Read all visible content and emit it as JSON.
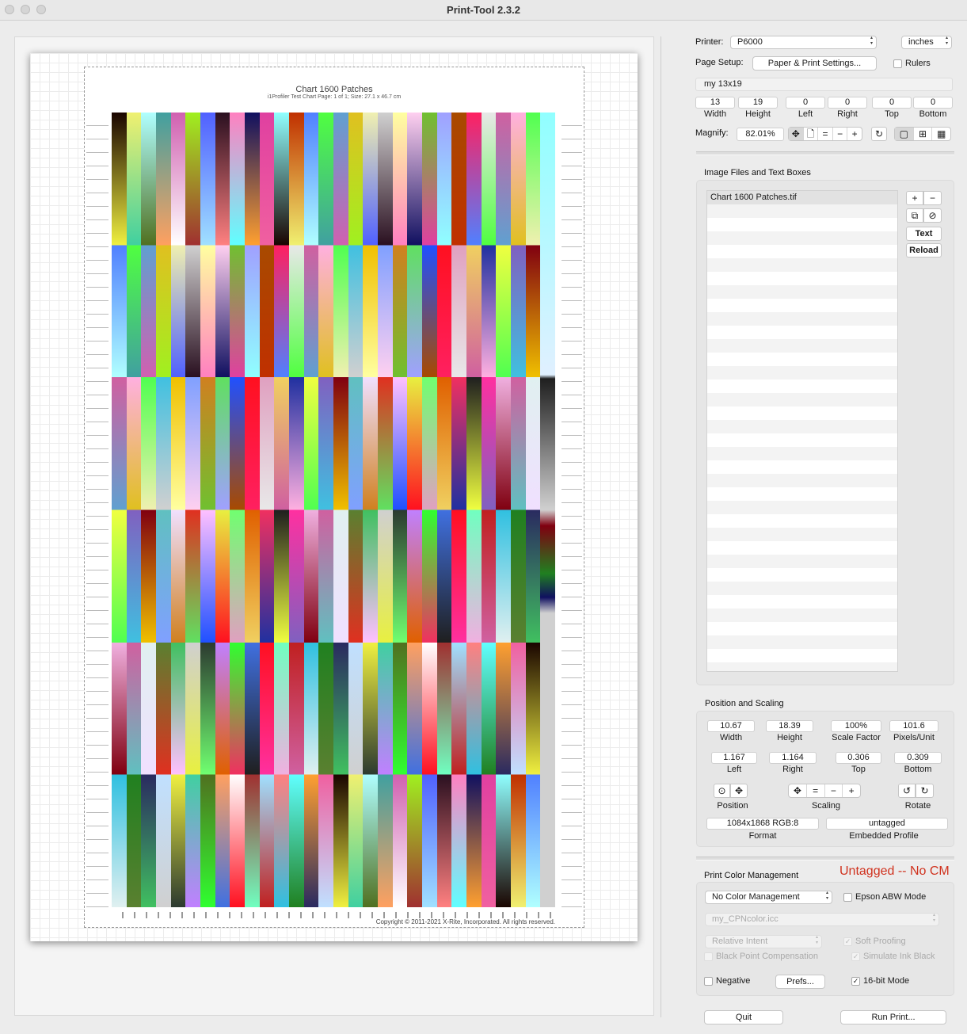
{
  "window": {
    "title": "Print-Tool 2.3.2"
  },
  "chart": {
    "title": "Chart 1600 Patches",
    "subtitle": "i1Profiler Test Chart Page: 1 of 1; Size: 27.1 x 46.7 cm",
    "copyright": "Copyright © 2011-2021 X-Rite, Incorporated. All rights reserved."
  },
  "printer": {
    "label": "Printer:",
    "value": "P6000",
    "units": "inches"
  },
  "page_setup": {
    "label": "Page Setup:",
    "button": "Paper & Print Settings...",
    "rulers_label": "Rulers",
    "paper_name": "my 13x19"
  },
  "paper_dims": [
    {
      "value": "13",
      "label": "Width"
    },
    {
      "value": "19",
      "label": "Height"
    },
    {
      "value": "0",
      "label": "Left"
    },
    {
      "value": "0",
      "label": "Right"
    },
    {
      "value": "0",
      "label": "Top"
    },
    {
      "value": "0",
      "label": "Bottom"
    }
  ],
  "magnify": {
    "label": "Magnify:",
    "value": "82.01%"
  },
  "image_files": {
    "title": "Image Files and Text Boxes",
    "items": [
      "Chart 1600 Patches.tif"
    ],
    "text_button": "Text",
    "reload_button": "Reload"
  },
  "position_scaling": {
    "title": "Position and Scaling",
    "row1": [
      {
        "value": "10.67",
        "label": "Width"
      },
      {
        "value": "18.39",
        "label": "Height"
      },
      {
        "value": "100%",
        "label": "Scale Factor"
      },
      {
        "value": "101.6",
        "label": "Pixels/Unit"
      }
    ],
    "row2": [
      {
        "value": "1.167",
        "label": "Left"
      },
      {
        "value": "1.164",
        "label": "Right"
      },
      {
        "value": "0.306",
        "label": "Top"
      },
      {
        "value": "0.309",
        "label": "Bottom"
      }
    ],
    "position_label": "Position",
    "scaling_label": "Scaling",
    "rotate_label": "Rotate",
    "format_value": "1084x1868 RGB:8",
    "format_label": "Format",
    "profile_value": "untagged",
    "profile_label": "Embedded Profile"
  },
  "color_mgmt": {
    "title": "Print Color Management",
    "status": "Untagged -- No CM",
    "mode": "No Color Management",
    "epson_abw": "Epson ABW Mode",
    "profile": "my_CPNcolor.icc",
    "intent": "Relative Intent",
    "soft_proofing": "Soft Proofing",
    "black_point": "Black Point Compensation",
    "simulate_ink": "Simulate Ink Black",
    "negative": "Negative",
    "prefs_button": "Prefs...",
    "bit16": "16-bit Mode"
  },
  "footer": {
    "quit": "Quit",
    "run": "Run Print..."
  },
  "chart_data": {
    "type": "heatmap",
    "title": "Chart 1600 Patches",
    "columns": 30,
    "rows": 54,
    "patch_colors": [
      [
        "#1a0500",
        "#a84a00",
        "#e8f040",
        "#f0f040",
        "#c03000",
        "#ff1020",
        "#2c3a30",
        "#f0f070",
        "#ff2060",
        "#70ff70",
        "#40d0a0",
        "#5080ff",
        "#e0a0c0",
        "#c080ff",
        "#b0ffff",
        "#e8e8e8"
      ],
      [
        "#e06000",
        "#507020",
        "#50ff40",
        "#f0d060",
        "#30ff30",
        "#40a0a0",
        "#d060a0",
        "#f03060",
        "#ffa060",
        "#60a0d0",
        "#2030a0",
        "#4070e0",
        "#d060b0",
        "#ffb0e0",
        "#1f1f1f",
        "#ffffff"
      ],
      [
        "#e0c020",
        "#f0ff40",
        "#ff1020",
        "#a0f020",
        "#50ff50",
        "#ff30a0",
        "#a03030",
        "#f0f0b0",
        "#8060c0",
        "#70ffc0",
        "#5060ff",
        "#40c0e0",
        "#f0b0e0",
        "#a0e0ff",
        "#d0d0d0",
        "#800010"
      ],
      [
        "#c02020",
        "#2a1020",
        "#f0c000",
        "#d060a0",
        "#ff8080",
        "#ffffa0",
        "#60c0c0",
        "#30c0e0",
        "#ff80c0",
        "#80a0ff",
        "#e0f0f0",
        "#60ffff",
        "#ffd0f0",
        "#f0e0ff",
        "#208020",
        "#101060"
      ],
      [
        "#d08020",
        "#5a8030",
        "#ffa030",
        "#70c030",
        "#e03020",
        "#2a2a60",
        "#e040a0",
        "#60e060",
        "#40c060",
        "#f060a0",
        "#a0a0ff",
        "#ffc0ff",
        "#c0e0ff",
        "#90ffff",
        "#2050ff",
        "#d0d0d0"
      ]
    ]
  }
}
